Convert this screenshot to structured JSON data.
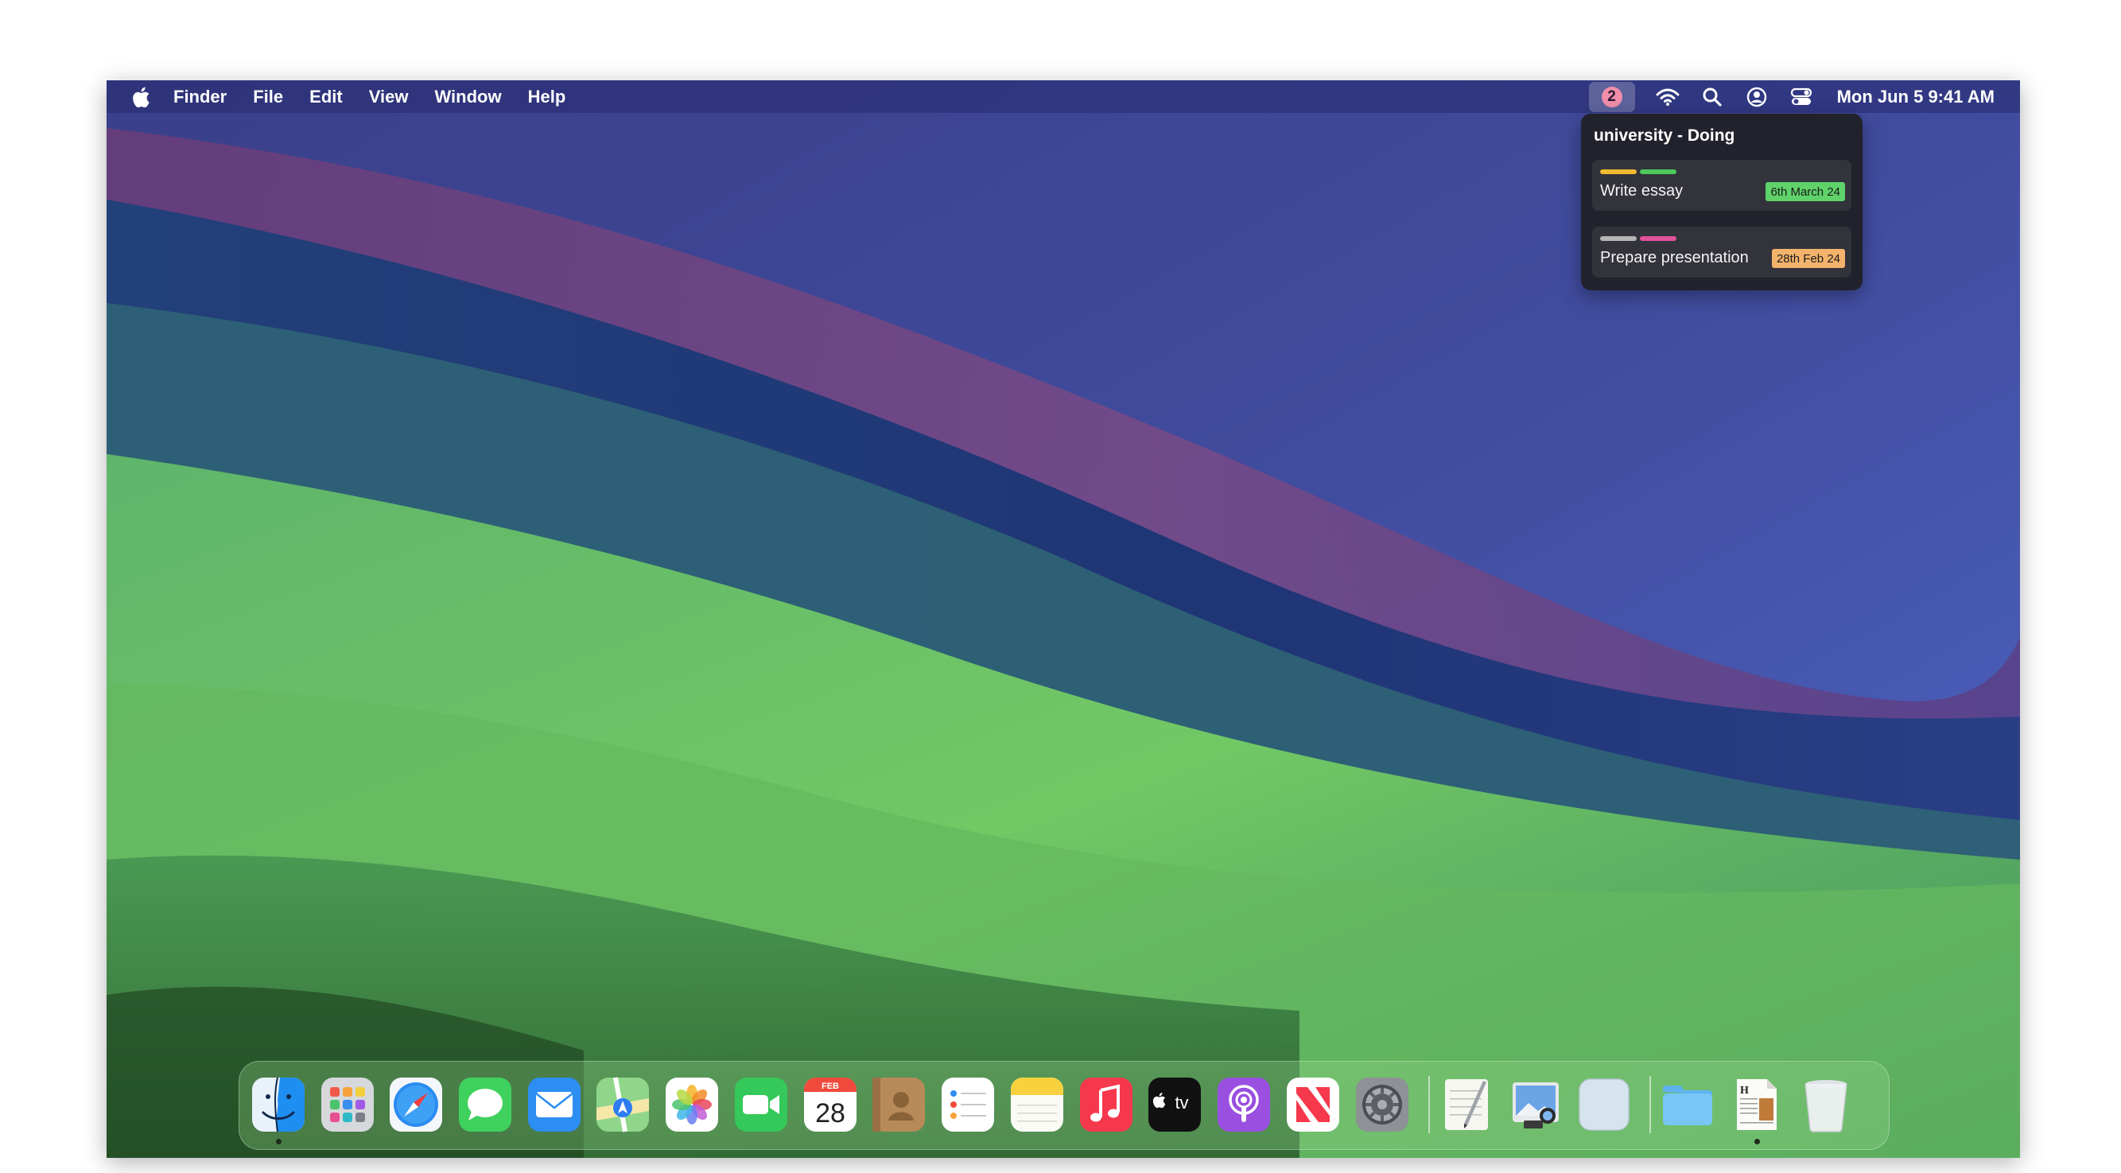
{
  "menubar": {
    "apple_icon": "apple-logo",
    "app_name": "Finder",
    "menus": [
      "File",
      "Edit",
      "View",
      "Window",
      "Help"
    ],
    "status_icons": [
      "wifi-icon",
      "search-icon",
      "user-icon",
      "control-center-icon"
    ],
    "badge_count": "2",
    "badge_color": "#f08ea9",
    "clock": "Mon Jun 5  9:41 AM"
  },
  "popover": {
    "title": "university - Doing",
    "tasks": [
      {
        "name": "Write essay",
        "due": "6th March 24",
        "due_color": "#5fd36a",
        "tag_colors": [
          "#f0b930",
          "#4cc85a"
        ]
      },
      {
        "name": "Prepare presentation",
        "due": "28th Feb 24",
        "due_color": "#f3b36b",
        "tag_colors": [
          "#b5b5b5",
          "#e0529a"
        ]
      }
    ]
  },
  "dock": {
    "apps": [
      "finder-icon",
      "launchpad-icon",
      "safari-icon",
      "messages-icon",
      "mail-icon",
      "maps-icon",
      "photos-icon",
      "facetime-icon",
      "calendar-icon",
      "contacts-icon",
      "reminders-icon",
      "notes-icon",
      "music-icon",
      "apple-tv-icon",
      "podcasts-icon",
      "news-icon",
      "system-settings-icon",
      "textedit-icon",
      "preview-icon",
      "blank-app-icon",
      "downloads-folder-icon",
      "document-icon",
      "trash-icon"
    ],
    "calendar_month": "FEB",
    "calendar_day": "28",
    "tv_label": "tv"
  }
}
